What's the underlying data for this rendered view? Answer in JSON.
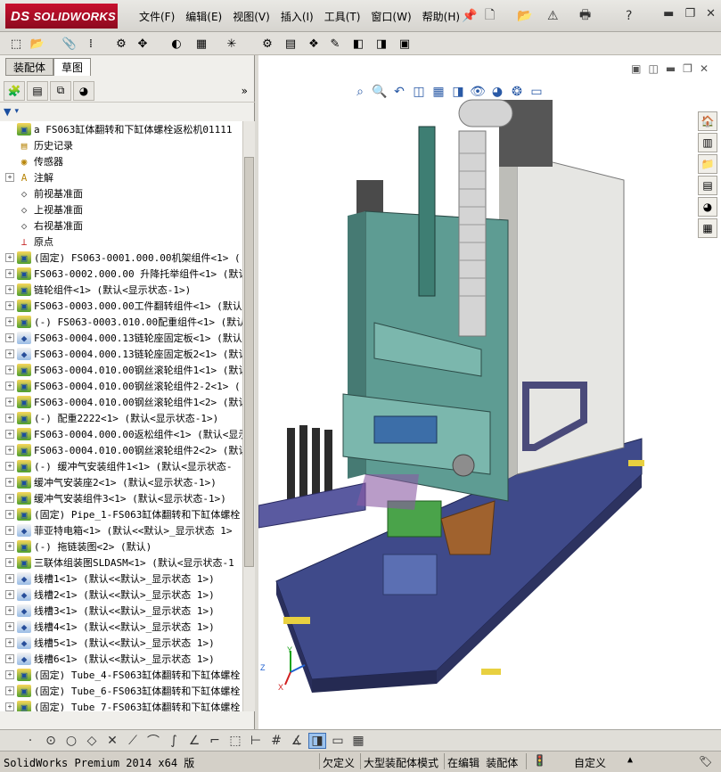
{
  "app": {
    "logo_ds": "DS",
    "logo_text": "SOLIDWORKS"
  },
  "menu": [
    "文件(F)",
    "编辑(E)",
    "视图(V)",
    "插入(I)",
    "工具(T)",
    "窗口(W)",
    "帮助(H)"
  ],
  "panel": {
    "tabs": [
      "装配体",
      "草图"
    ],
    "tree": [
      {
        "label": "a  FS063缸体翻转和下缸体螺栓返松机01111",
        "icon": "assembly-icon",
        "expander": "none"
      },
      {
        "label": "历史记录",
        "icon": "history-folder-icon",
        "expander": "none"
      },
      {
        "label": "传感器",
        "icon": "sensor-folder-icon",
        "expander": "none"
      },
      {
        "label": "注解",
        "icon": "annotation-icon",
        "expander": "plus"
      },
      {
        "label": "前视基准面",
        "icon": "plane-icon",
        "expander": "none"
      },
      {
        "label": "上视基准面",
        "icon": "plane-icon",
        "expander": "none"
      },
      {
        "label": "右视基准面",
        "icon": "plane-icon",
        "expander": "none"
      },
      {
        "label": "原点",
        "icon": "origin-icon",
        "expander": "none"
      },
      {
        "label": "(固定) FS063-0001.000.00机架组件<1> (",
        "icon": "subassembly-icon",
        "expander": "plus"
      },
      {
        "label": "FS063-0002.000.00 升降托举组件<1> (默认",
        "icon": "subassembly-icon",
        "expander": "plus"
      },
      {
        "label": "链轮组件<1> (默认<显示状态-1>)",
        "icon": "subassembly-icon",
        "expander": "plus"
      },
      {
        "label": "FS063-0003.000.00工件翻转组件<1> (默认",
        "icon": "subassembly-icon",
        "expander": "plus"
      },
      {
        "label": "(-) FS063-0003.010.00配重组件<1> (默认",
        "icon": "subassembly-icon",
        "expander": "plus"
      },
      {
        "label": "FS063-0004.000.13链轮座固定板<1> (默认",
        "icon": "part-icon",
        "expander": "plus"
      },
      {
        "label": "FS063-0004.000.13链轮座固定板2<1> (默认",
        "icon": "part-icon",
        "expander": "plus"
      },
      {
        "label": "FS063-0004.010.00钢丝滚轮组件1<1> (默认",
        "icon": "subassembly-icon",
        "expander": "plus"
      },
      {
        "label": "FS063-0004.010.00钢丝滚轮组件2-2<1> (",
        "icon": "subassembly-icon",
        "expander": "plus"
      },
      {
        "label": "FS063-0004.010.00钢丝滚轮组件1<2> (默认",
        "icon": "subassembly-icon",
        "expander": "plus"
      },
      {
        "label": "(-) 配重2222<1> (默认<显示状态-1>)",
        "icon": "subassembly-icon",
        "expander": "plus"
      },
      {
        "label": "FS063-0004.000.00返松组件<1> (默认<显示",
        "icon": "subassembly-icon",
        "expander": "plus"
      },
      {
        "label": "FS063-0004.010.00钢丝滚轮组件2<2> (默认",
        "icon": "subassembly-icon",
        "expander": "plus"
      },
      {
        "label": "(-) 缓冲气安装组件1<1> (默认<显示状态-",
        "icon": "subassembly-icon",
        "expander": "plus"
      },
      {
        "label": "缓冲气安装座2<1> (默认<显示状态-1>)",
        "icon": "subassembly-icon",
        "expander": "plus"
      },
      {
        "label": "缓冲气安装组件3<1> (默认<显示状态-1>)",
        "icon": "subassembly-icon",
        "expander": "plus"
      },
      {
        "label": "(固定) Pipe_1-FS063缸体翻转和下缸体螺栓",
        "icon": "subassembly-icon",
        "expander": "plus"
      },
      {
        "label": "菲亚特电箱<1> (默认<<默认>_显示状态 1>",
        "icon": "part-icon",
        "expander": "plus"
      },
      {
        "label": "(-) 拖链装图<2> (默认)",
        "icon": "subassembly-icon",
        "expander": "plus"
      },
      {
        "label": "三联体组装图SLDASM<1> (默认<显示状态-1",
        "icon": "subassembly-icon",
        "expander": "plus"
      },
      {
        "label": "线槽1<1> (默认<<默认>_显示状态 1>)",
        "icon": "part-icon",
        "expander": "plus"
      },
      {
        "label": "线槽2<1> (默认<<默认>_显示状态 1>)",
        "icon": "part-icon",
        "expander": "plus"
      },
      {
        "label": "线槽3<1> (默认<<默认>_显示状态 1>)",
        "icon": "part-icon",
        "expander": "plus"
      },
      {
        "label": "线槽4<1> (默认<<默认>_显示状态 1>)",
        "icon": "part-icon",
        "expander": "plus"
      },
      {
        "label": "线槽5<1> (默认<<默认>_显示状态 1>)",
        "icon": "part-icon",
        "expander": "plus"
      },
      {
        "label": "线槽6<1> (默认<<默认>_显示状态 1>)",
        "icon": "part-icon",
        "expander": "plus"
      },
      {
        "label": "(固定) Tube_4-FS063缸体翻转和下缸体螺栓",
        "icon": "subassembly-icon",
        "expander": "plus"
      },
      {
        "label": "(固定) Tube_6-FS063缸体翻转和下缸体螺栓",
        "icon": "subassembly-icon",
        "expander": "plus"
      },
      {
        "label": "(固定) Tube_7-FS063缸体翻转和下缸体螺栓",
        "icon": "subassembly-icon",
        "expander": "plus"
      }
    ]
  },
  "triad": {
    "x": "X",
    "y": "Y",
    "z": "Z"
  },
  "status": {
    "product": "SolidWorks Premium 2014 x64 版",
    "underdefined": "欠定义",
    "mode": "大型装配体模式",
    "editing": "在编辑 装配体",
    "custom": "自定义"
  }
}
